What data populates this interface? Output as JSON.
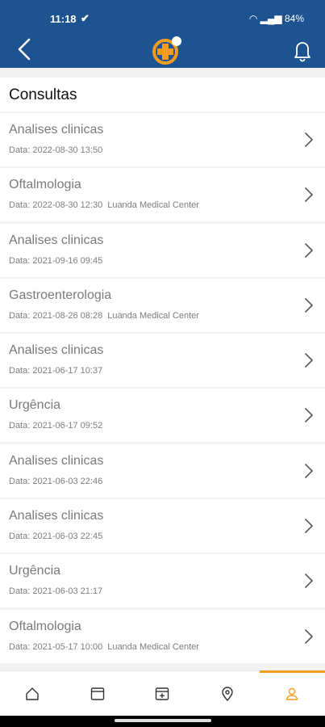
{
  "status": {
    "time": "11:18",
    "battery": "84%"
  },
  "section": {
    "title": "Consultas"
  },
  "appointments": [
    {
      "title": "Analises clinicas",
      "date": "Data: 2022-08-30 13:50",
      "location": ""
    },
    {
      "title": "Oftalmologia",
      "date": "Data: 2022-08-30 12:30",
      "location": "Luanda Medical Center"
    },
    {
      "title": "Analises clinicas",
      "date": "Data: 2021-09-16 09:45",
      "location": ""
    },
    {
      "title": "Gastroenterologia",
      "date": "Data: 2021-08-26 08:28",
      "location": "Luanda Medical Center"
    },
    {
      "title": "Analises clinicas",
      "date": "Data: 2021-06-17 10:37",
      "location": ""
    },
    {
      "title": "Urgência",
      "date": "Data: 2021-06-17 09:52",
      "location": ""
    },
    {
      "title": "Analises clinicas",
      "date": "Data: 2021-06-03 22:46",
      "location": ""
    },
    {
      "title": "Analises clinicas",
      "date": "Data: 2021-06-03 22:45",
      "location": ""
    },
    {
      "title": "Urgência",
      "date": "Data: 2021-06-03 21:17",
      "location": ""
    },
    {
      "title": "Oftalmologia",
      "date": "Data: 2021-05-17 10:00",
      "location": "Luanda Medical Center"
    }
  ],
  "nav": [
    {
      "icon": "home-icon"
    },
    {
      "icon": "calendar-icon"
    },
    {
      "icon": "calendar-add-icon"
    },
    {
      "icon": "location-pin-icon"
    },
    {
      "icon": "user-icon",
      "active": true
    }
  ],
  "colors": {
    "header": "#1c5390",
    "accent": "#f39c1f"
  }
}
